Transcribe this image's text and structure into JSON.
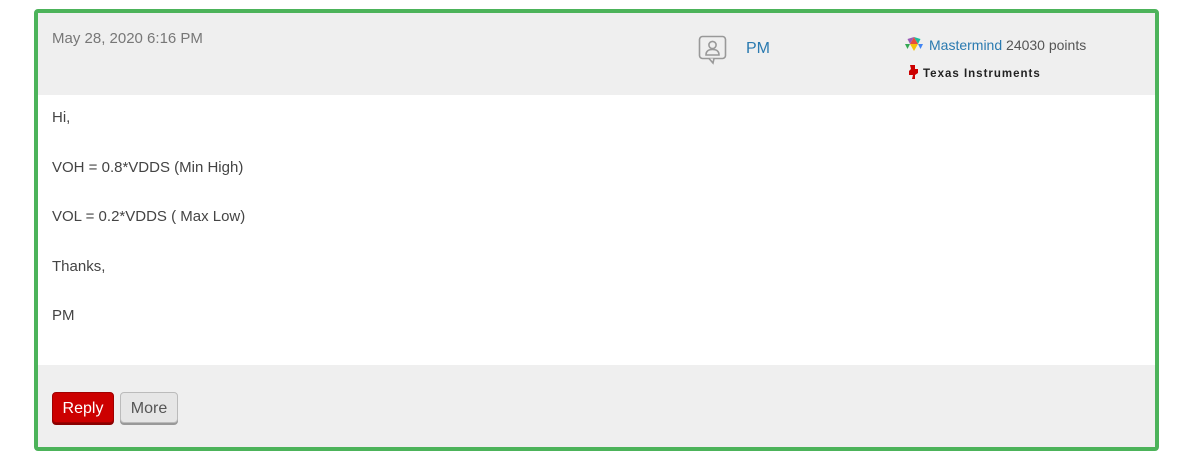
{
  "post": {
    "date": "May 28, 2020 6:16 PM",
    "author": "PM",
    "rank_label": "Mastermind",
    "points": "24030 points",
    "company": "Texas Instruments",
    "body_lines": [
      "Hi,",
      "VOH = 0.8*VDDS (Min High)",
      "VOL = 0.2*VDDS ( Max Low)",
      "Thanks,",
      "PM"
    ]
  },
  "actions": {
    "reply_label": "Reply",
    "more_label": "More"
  },
  "colors": {
    "border_accent": "#4cb35a",
    "link": "#2a7ab0",
    "reply_button": "#cc0000"
  },
  "icons": {
    "avatar": "user-avatar-icon",
    "rank": "mastermind-rank-icon",
    "company": "texas-instruments-icon"
  }
}
